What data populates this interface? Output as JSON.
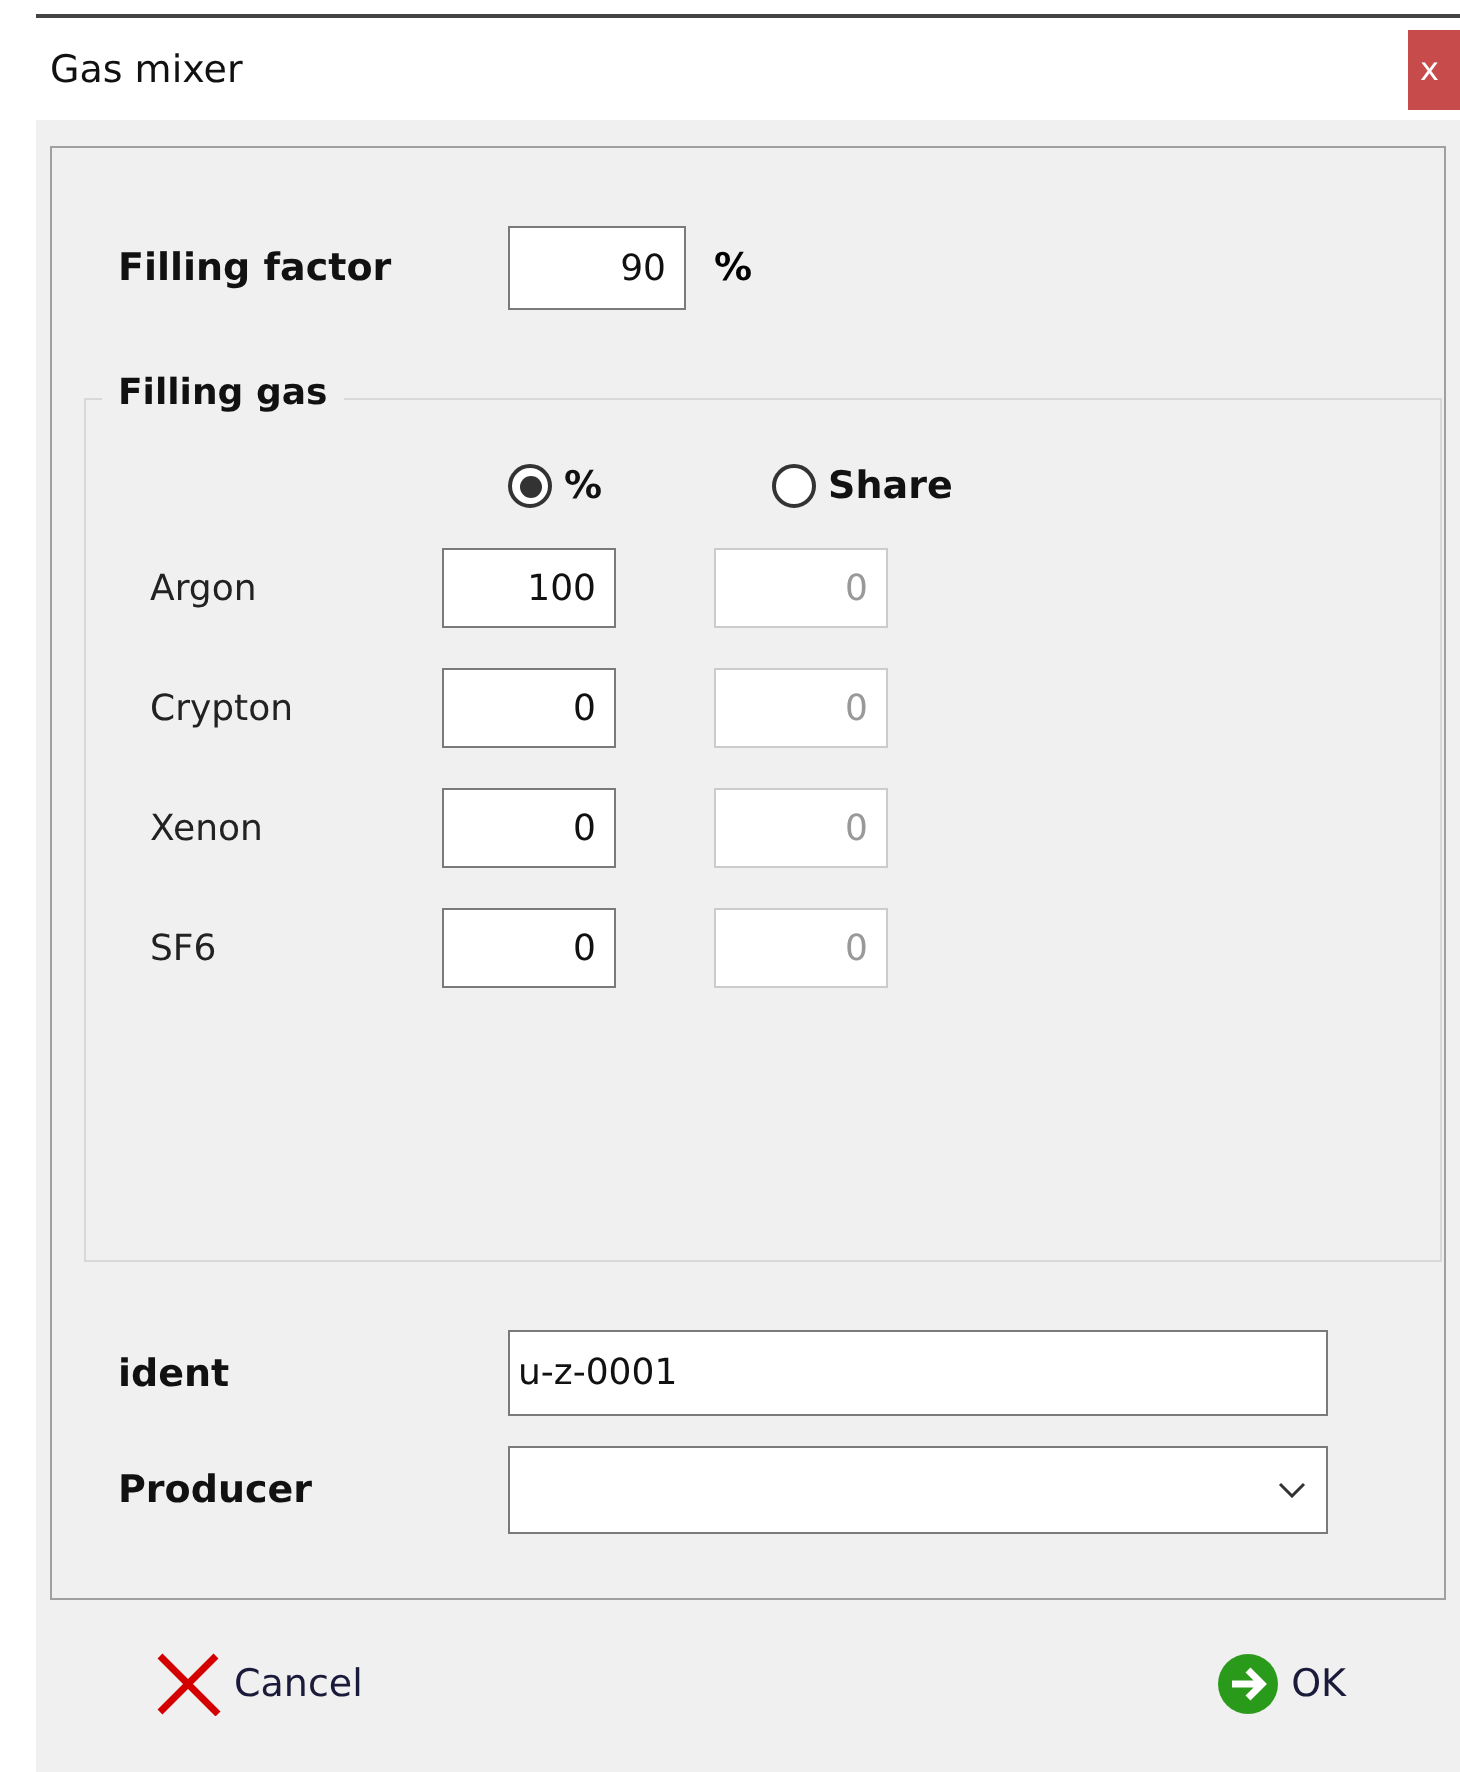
{
  "window": {
    "title": "Gas mixer",
    "close": "x"
  },
  "filling_factor": {
    "label": "Filling factor",
    "value": "90",
    "unit": "%"
  },
  "filling_gas": {
    "title": "Filling gas",
    "modes": [
      {
        "label": "%",
        "selected": true
      },
      {
        "label": "Share",
        "selected": false
      }
    ],
    "gases": [
      {
        "name": "Argon",
        "percent": "100",
        "share": "0",
        "share_disabled": true
      },
      {
        "name": "Crypton",
        "percent": "0",
        "share": "0",
        "share_disabled": true
      },
      {
        "name": "Xenon",
        "percent": "0",
        "share": "0",
        "share_disabled": true
      },
      {
        "name": "SF6",
        "percent": "0",
        "share": "0",
        "share_disabled": true
      }
    ]
  },
  "ident": {
    "label": "ident",
    "value": "u-z-0001"
  },
  "producer": {
    "label": "Producer"
  },
  "buttons": [
    {
      "kind": "cancel",
      "label": "Cancel"
    },
    {
      "kind": "ok",
      "label": "OK"
    }
  ]
}
